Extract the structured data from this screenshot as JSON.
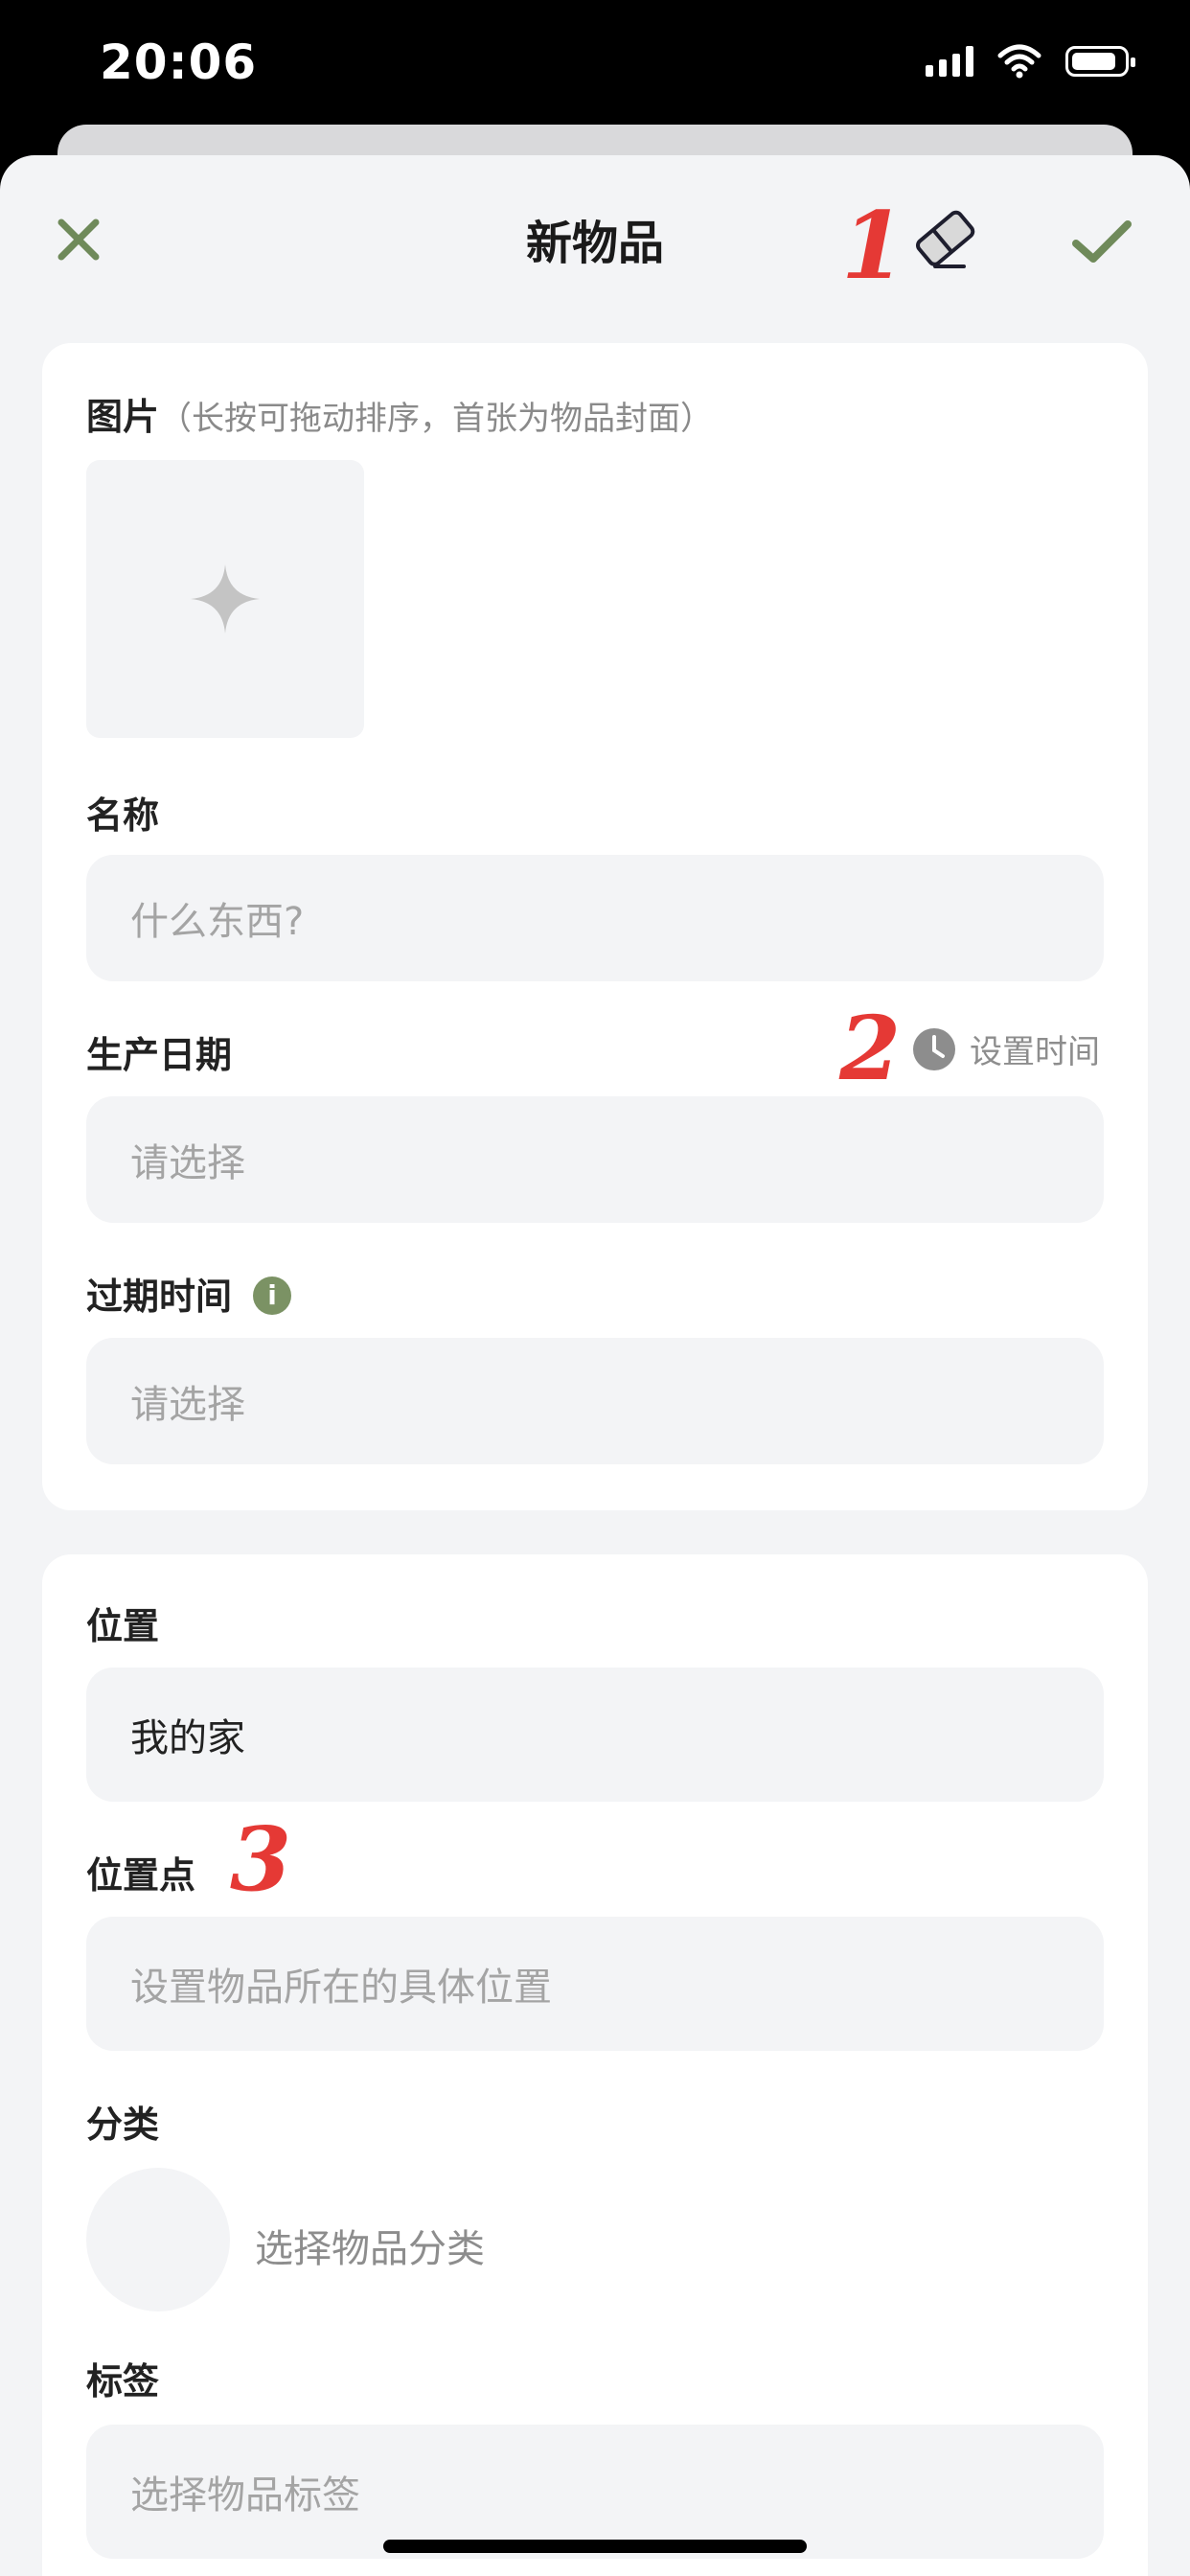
{
  "status_bar": {
    "time": "20:06",
    "battery_level": 0.88
  },
  "nav": {
    "title": "新物品",
    "close_icon": "close-icon",
    "eraser_icon": "eraser-icon",
    "confirm_icon": "check-icon",
    "accent_color": "#6f8a5a"
  },
  "annotations": {
    "a1": "1",
    "a2": "2",
    "a3": "3",
    "color": "#e53935"
  },
  "basic_card": {
    "photos_label": "图片",
    "photos_hint": "（长按可拖动排序，首张为物品封面）",
    "add_photo_icon": "plus-icon",
    "name_label": "名称",
    "name_placeholder": "什么东西?",
    "production_date_label": "生产日期",
    "set_time_label": "设置时间",
    "production_date_placeholder": "请选择",
    "expiry_label": "过期时间",
    "expiry_info_icon": "info-icon",
    "expiry_placeholder": "请选择"
  },
  "location_card": {
    "location_label": "位置",
    "location_value": "我的家",
    "spot_label": "位置点",
    "spot_placeholder": "设置物品所在的具体位置",
    "category_label": "分类",
    "category_placeholder": "选择物品分类",
    "tags_label": "标签",
    "tags_placeholder": "选择物品标签"
  }
}
